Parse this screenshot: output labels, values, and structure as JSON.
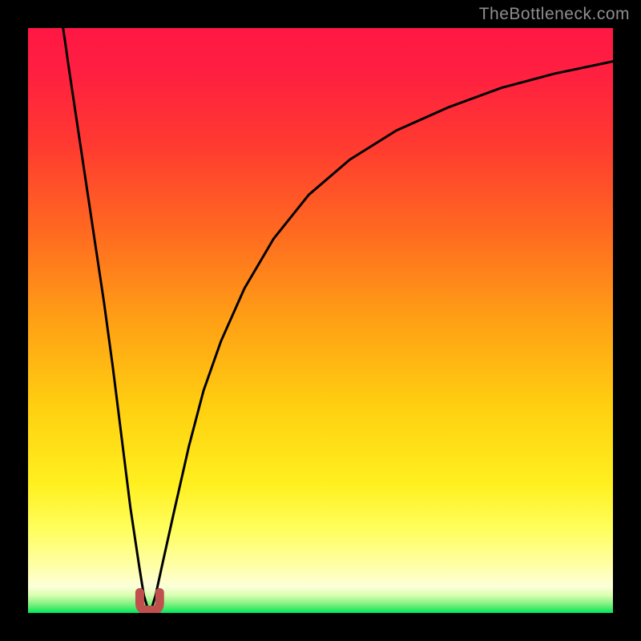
{
  "watermark": {
    "text": "TheBottleneck.com"
  },
  "chart_data": {
    "type": "line",
    "title": "",
    "xlabel": "",
    "ylabel": "",
    "xlim": [
      0,
      1
    ],
    "ylim": [
      0,
      1
    ],
    "grid": false,
    "background_gradient": [
      {
        "t": 0.0,
        "color": "#ff1744"
      },
      {
        "t": 0.08,
        "color": "#ff2040"
      },
      {
        "t": 0.2,
        "color": "#ff3a30"
      },
      {
        "t": 0.35,
        "color": "#ff6a20"
      },
      {
        "t": 0.5,
        "color": "#ffa015"
      },
      {
        "t": 0.65,
        "color": "#ffd010"
      },
      {
        "t": 0.78,
        "color": "#fff020"
      },
      {
        "t": 0.86,
        "color": "#ffff60"
      },
      {
        "t": 0.92,
        "color": "#ffffa8"
      },
      {
        "t": 0.955,
        "color": "#fcffd8"
      },
      {
        "t": 0.97,
        "color": "#d8ffb0"
      },
      {
        "t": 0.985,
        "color": "#80f080"
      },
      {
        "t": 1.0,
        "color": "#00e85a"
      }
    ],
    "series": [
      {
        "name": "bottleneck-curve",
        "stroke": "#000000",
        "stroke_width": 3,
        "points": [
          [
            0.06,
            1.0
          ],
          [
            0.07,
            0.93
          ],
          [
            0.085,
            0.83
          ],
          [
            0.1,
            0.73
          ],
          [
            0.115,
            0.63
          ],
          [
            0.13,
            0.53
          ],
          [
            0.145,
            0.42
          ],
          [
            0.16,
            0.3
          ],
          [
            0.175,
            0.18
          ],
          [
            0.19,
            0.08
          ],
          [
            0.198,
            0.03
          ],
          [
            0.204,
            0.01
          ],
          [
            0.212,
            0.01
          ],
          [
            0.218,
            0.03
          ],
          [
            0.23,
            0.085
          ],
          [
            0.25,
            0.175
          ],
          [
            0.275,
            0.285
          ],
          [
            0.3,
            0.38
          ],
          [
            0.33,
            0.465
          ],
          [
            0.37,
            0.555
          ],
          [
            0.42,
            0.64
          ],
          [
            0.48,
            0.715
          ],
          [
            0.55,
            0.775
          ],
          [
            0.63,
            0.825
          ],
          [
            0.72,
            0.865
          ],
          [
            0.81,
            0.898
          ],
          [
            0.9,
            0.922
          ],
          [
            1.0,
            0.943
          ]
        ]
      },
      {
        "name": "optimum-marker",
        "type": "marker-u",
        "color": "#c0504d",
        "center_x": 0.208,
        "width": 0.034,
        "baseline_y": 0.005,
        "top_y": 0.035
      }
    ]
  }
}
